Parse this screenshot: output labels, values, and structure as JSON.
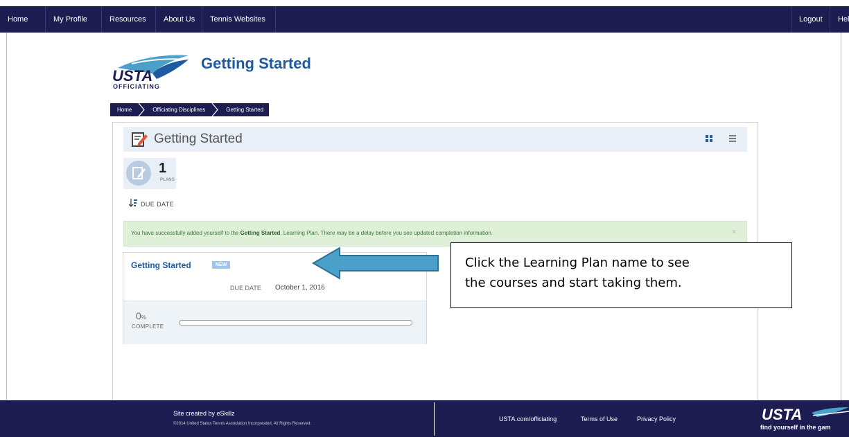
{
  "nav": {
    "left_items": [
      "Home",
      "My Profile",
      "Resources",
      "About Us",
      "Tennis Websites"
    ],
    "right_items": [
      "Logout",
      "Hel"
    ]
  },
  "header": {
    "logo_text": "USTA",
    "logo_sub": "OFFICIATING",
    "title": "Getting Started"
  },
  "breadcrumb": [
    "Home",
    "Officiating Disciplines",
    "Getting Started"
  ],
  "panel": {
    "title": "Getting Started",
    "plans_count": "1",
    "plans_label": "PLANS",
    "sort_label": "DUE DATE"
  },
  "alert": {
    "text_before": "You have successfully added yourself to the ",
    "plan_name": "Getting Started",
    "text_after": ". Learning Plan. There may be a delay before you see updated completion information.",
    "close": "×"
  },
  "card": {
    "title": "Getting Started",
    "badge": "NEW",
    "due_label": "DUE DATE",
    "due_date": "October 1, 2016",
    "percent": "0",
    "percent_sign": "%",
    "complete_label": "COMPLETE",
    "progress_fraction": 0
  },
  "callout": {
    "line1": "Click the Learning Plan name to see",
    "line2": "the courses and start taking them."
  },
  "footer": {
    "credit": "Site created by eSkillz",
    "copyright": "©2014 United States Tennis Association Incorporated. All Rights Reserved.",
    "links": [
      "USTA.com/officiating",
      "Terms of Use",
      "Privacy Policy"
    ],
    "logo_text": "USTA",
    "tagline": "find yourself in the gam"
  },
  "colors": {
    "nav_bg": "#1d1d52",
    "title_blue": "#1d5aa0",
    "alert_bg": "#dff0d8",
    "arrow_fill": "#4aa0c8"
  }
}
